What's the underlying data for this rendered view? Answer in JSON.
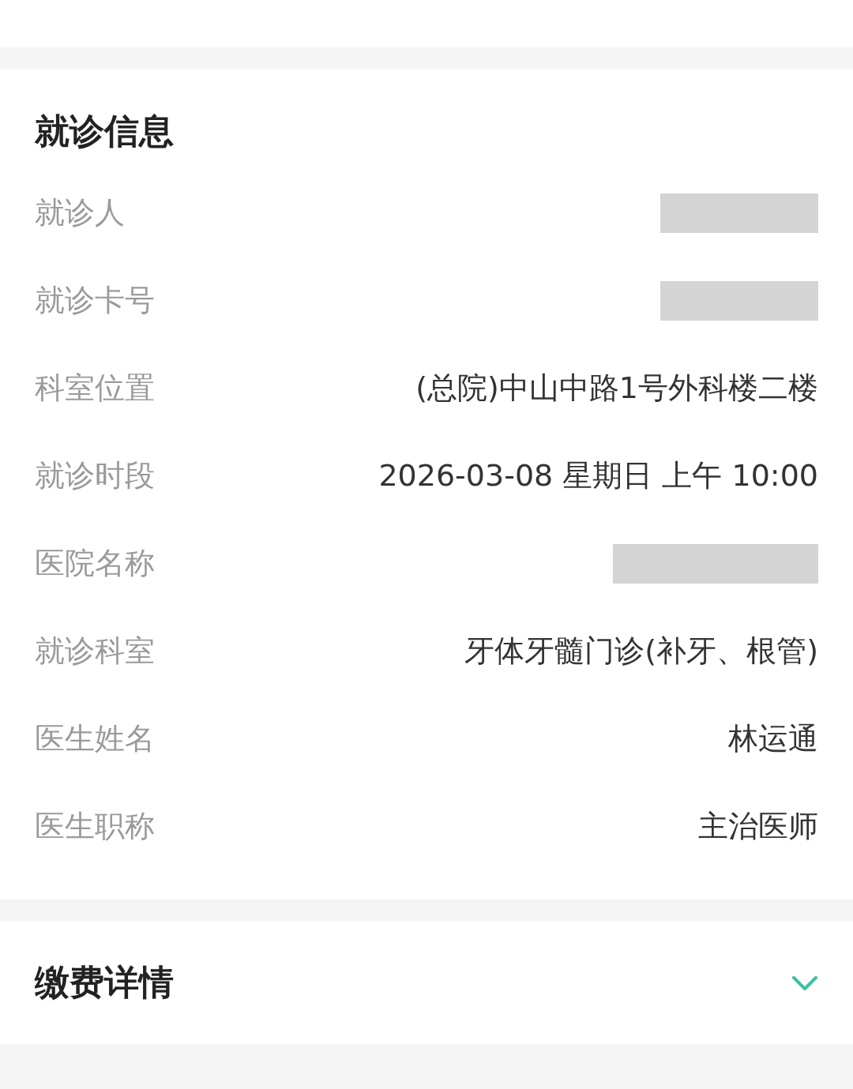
{
  "visit_info": {
    "title": "就诊信息",
    "rows": [
      {
        "label": "就诊人",
        "kind": "redacted"
      },
      {
        "label": "就诊卡号",
        "kind": "redacted"
      },
      {
        "label": "科室位置",
        "kind": "text",
        "value": "(总院)中山中路1号外科楼二楼"
      },
      {
        "label": "就诊时段",
        "kind": "text",
        "value": "2026-03-08 星期日 上午 10:00"
      },
      {
        "label": "医院名称",
        "kind": "redacted"
      },
      {
        "label": "就诊科室",
        "kind": "text",
        "value": "牙体牙髓门诊(补牙、根管)"
      },
      {
        "label": "医生姓名",
        "kind": "text",
        "value": "林运通"
      },
      {
        "label": "医生职称",
        "kind": "text",
        "value": "主治医师"
      }
    ]
  },
  "payment": {
    "title": "缴费详情",
    "expanded": false
  }
}
